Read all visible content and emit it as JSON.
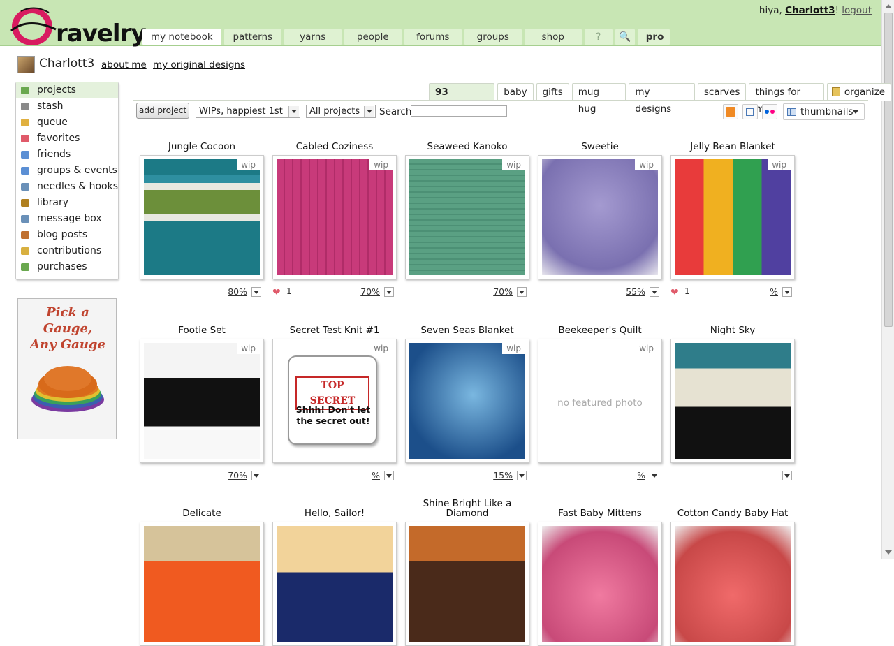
{
  "header": {
    "logo_text": "ravelry",
    "greeting_prefix": "hiya, ",
    "username": "Charlott3",
    "greeting_suffix": "!",
    "logout": "logout",
    "nav": [
      "my notebook",
      "patterns",
      "yarns",
      "people",
      "forums",
      "groups",
      "shop",
      "?",
      "🔍",
      "pro"
    ]
  },
  "profile": {
    "name": "Charlott3",
    "about": "about me",
    "designs": "my original designs"
  },
  "sidebar": {
    "items": [
      {
        "label": "projects",
        "icon": "projects-icon",
        "color": "#6aa84f"
      },
      {
        "label": "stash",
        "icon": "stash-icon",
        "color": "#8a8a8a"
      },
      {
        "label": "queue",
        "icon": "queue-icon",
        "color": "#e0b040"
      },
      {
        "label": "favorites",
        "icon": "heart-icon",
        "color": "#e05a6a"
      },
      {
        "label": "friends",
        "icon": "friends-icon",
        "color": "#5b8fd4"
      },
      {
        "label": "groups & events",
        "icon": "groups-icon",
        "color": "#5b8fd4"
      },
      {
        "label": "needles & hooks",
        "icon": "needles-icon",
        "color": "#6a90b8"
      },
      {
        "label": "library",
        "icon": "library-icon",
        "color": "#b08020"
      },
      {
        "label": "message box",
        "icon": "message-icon",
        "color": "#6a90b8"
      },
      {
        "label": "blog posts",
        "icon": "blog-icon",
        "color": "#c07030"
      },
      {
        "label": "contributions",
        "icon": "pencil-icon",
        "color": "#d8b040"
      },
      {
        "label": "purchases",
        "icon": "tag-icon",
        "color": "#6aa84f"
      }
    ]
  },
  "ad": {
    "line1": "Pick a Gauge,",
    "line2": "Any Gauge"
  },
  "tabs": [
    {
      "count": "93",
      "label": " projects"
    },
    {
      "label": "baby"
    },
    {
      "label": "gifts"
    },
    {
      "label": "mug hug"
    },
    {
      "label": "my designs"
    },
    {
      "label": "scarves"
    },
    {
      "label": "things for me"
    },
    {
      "label": "organize"
    }
  ],
  "toolbar": {
    "add_project": "add project",
    "sort": "WIPs, happiest 1st",
    "filter": "All projects",
    "search_label": "Search",
    "search_value": "",
    "view": "thumbnails"
  },
  "projects": [
    {
      "title": "Jungle Cocoon",
      "status": "wip",
      "progress": "80%",
      "hearts": ""
    },
    {
      "title": "Cabled Coziness",
      "status": "wip",
      "progress": "70%",
      "hearts": "1"
    },
    {
      "title": "Seaweed Kanoko",
      "status": "wip",
      "progress": "70%",
      "hearts": ""
    },
    {
      "title": "Sweetie",
      "status": "wip",
      "progress": "55%",
      "hearts": ""
    },
    {
      "title": "Jelly Bean Blanket",
      "status": "wip",
      "progress": "%",
      "hearts": "1"
    },
    {
      "title": "Footie Set",
      "status": "wip",
      "progress": "70%",
      "hearts": ""
    },
    {
      "title": "Secret Test Knit #1",
      "status": "wip",
      "progress": "%",
      "hearts": "",
      "secret_line1": "TOP SECRET",
      "secret_line2": "Shhh! Don't let the secret out!"
    },
    {
      "title": "Seven Seas Blanket",
      "status": "wip",
      "progress": "15%",
      "hearts": ""
    },
    {
      "title": "Beekeeper's Quilt",
      "status": "wip",
      "progress": "%",
      "hearts": "",
      "no_photo": "no featured photo"
    },
    {
      "title": "Night Sky",
      "status": "",
      "progress": "",
      "hearts": ""
    },
    {
      "title": "Delicate",
      "status": "",
      "progress": "",
      "hearts": ""
    },
    {
      "title": "Hello, Sailor!",
      "status": "",
      "progress": "",
      "hearts": ""
    },
    {
      "title": "Shine Bright Like a Diamond",
      "status": "",
      "progress": "",
      "hearts": ""
    },
    {
      "title": "Fast Baby Mittens",
      "status": "",
      "progress": "",
      "hearts": ""
    },
    {
      "title": "Cotton Candy Baby Hat",
      "status": "",
      "progress": "",
      "hearts": ""
    }
  ]
}
